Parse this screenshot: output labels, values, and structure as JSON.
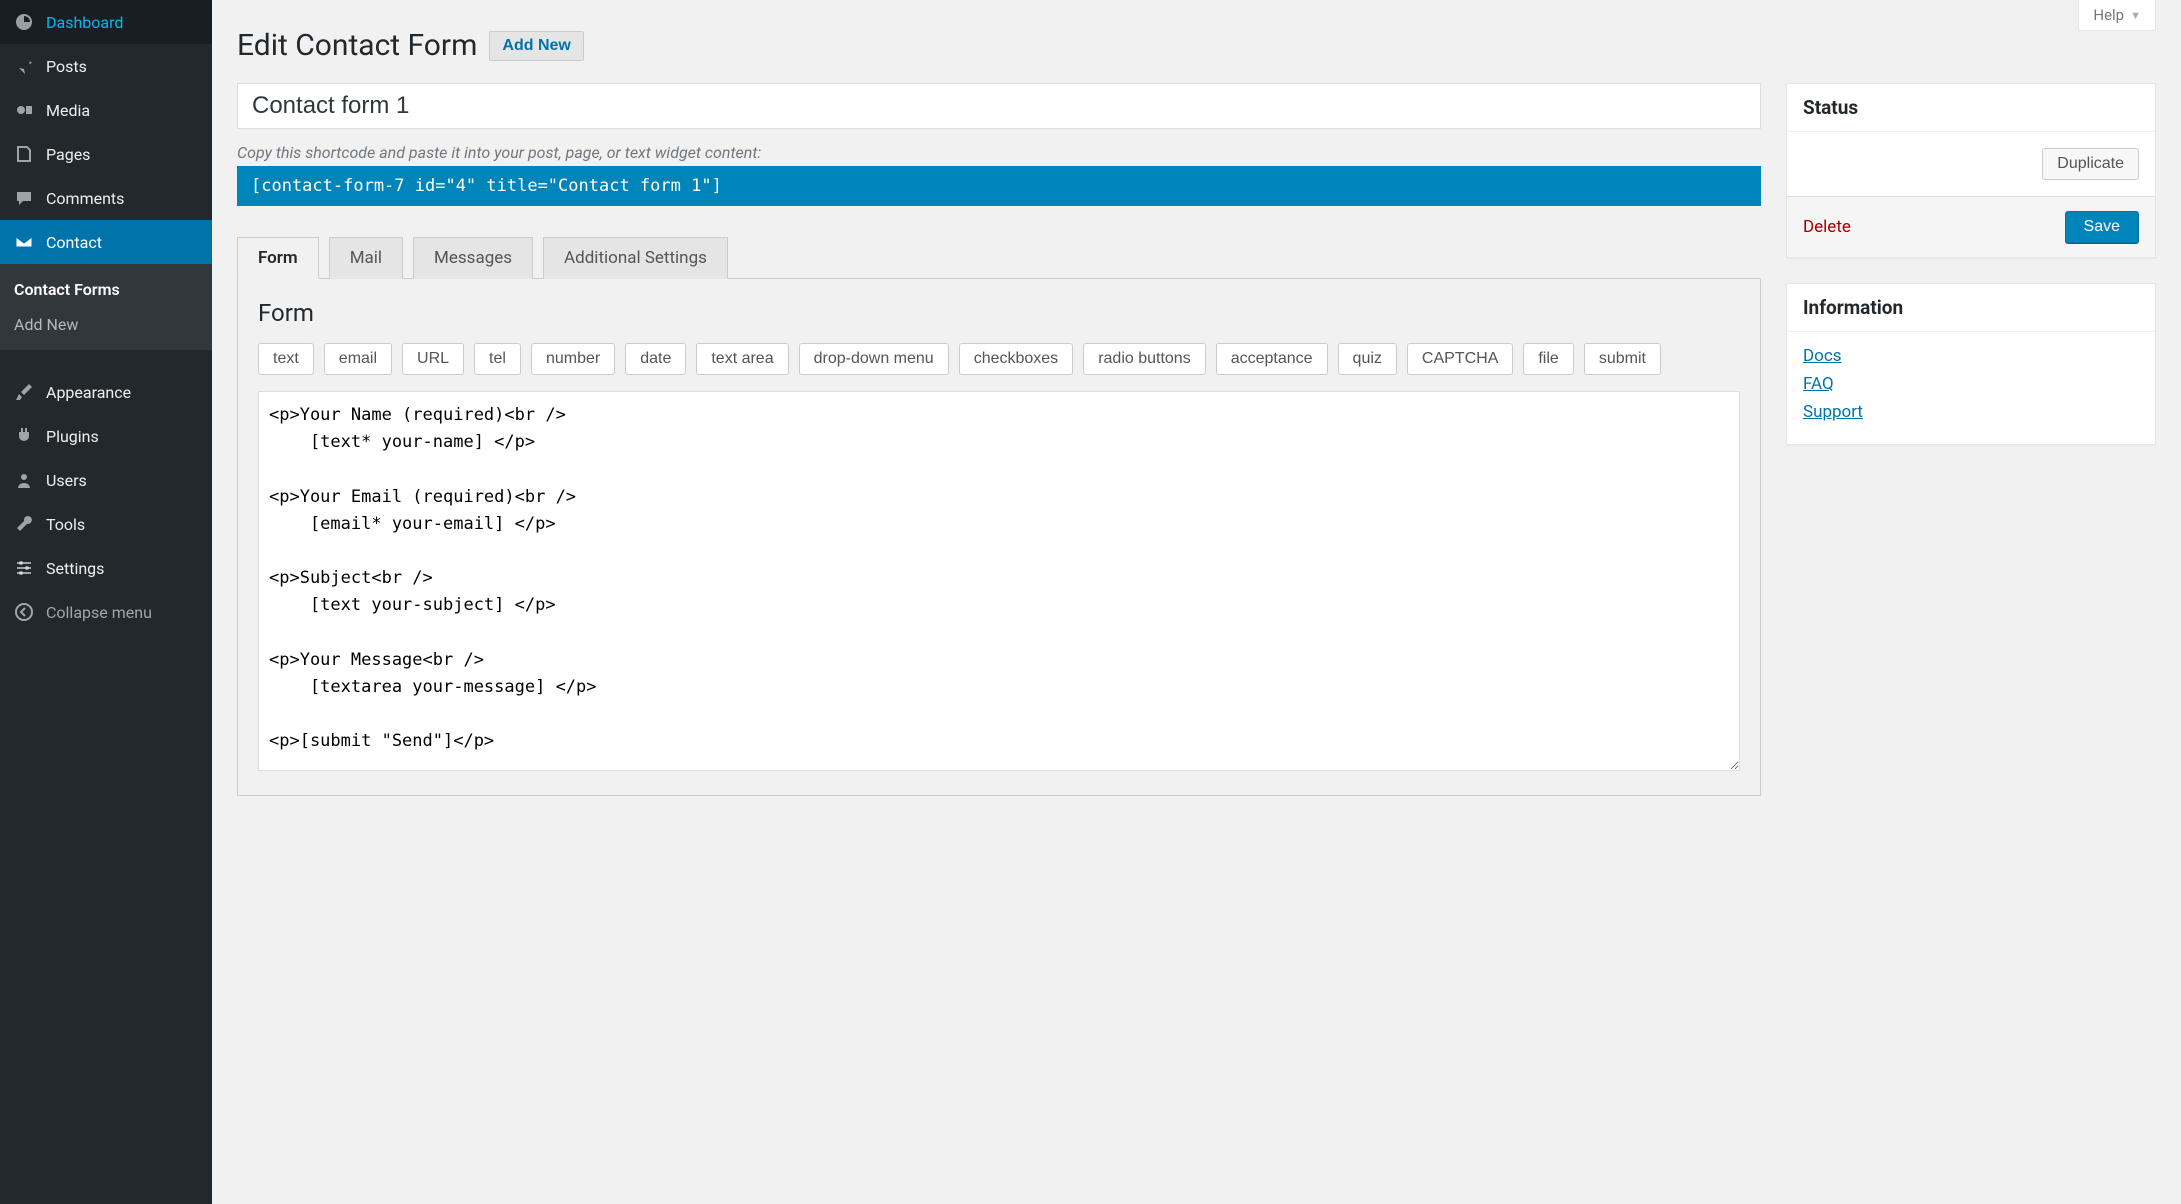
{
  "help_label": "Help",
  "sidebar": {
    "items": [
      {
        "label": "Dashboard"
      },
      {
        "label": "Posts"
      },
      {
        "label": "Media"
      },
      {
        "label": "Pages"
      },
      {
        "label": "Comments"
      },
      {
        "label": "Contact"
      },
      {
        "label": "Appearance"
      },
      {
        "label": "Plugins"
      },
      {
        "label": "Users"
      },
      {
        "label": "Tools"
      },
      {
        "label": "Settings"
      }
    ],
    "submenu": [
      {
        "label": "Contact Forms"
      },
      {
        "label": "Add New"
      }
    ],
    "collapse_label": "Collapse menu"
  },
  "page": {
    "title": "Edit Contact Form",
    "add_new_label": "Add New",
    "form_title_value": "Contact form 1",
    "shortcode_hint": "Copy this shortcode and paste it into your post, page, or text widget content:",
    "shortcode": "[contact-form-7 id=\"4\" title=\"Contact form 1\"]"
  },
  "tabs": [
    {
      "label": "Form"
    },
    {
      "label": "Mail"
    },
    {
      "label": "Messages"
    },
    {
      "label": "Additional Settings"
    }
  ],
  "form_panel": {
    "heading": "Form",
    "tag_buttons": [
      "text",
      "email",
      "URL",
      "tel",
      "number",
      "date",
      "text area",
      "drop-down menu",
      "checkboxes",
      "radio buttons",
      "acceptance",
      "quiz",
      "CAPTCHA",
      "file",
      "submit"
    ],
    "content": "<p>Your Name (required)<br />\n    [text* your-name] </p>\n\n<p>Your Email (required)<br />\n    [email* your-email] </p>\n\n<p>Subject<br />\n    [text your-subject] </p>\n\n<p>Your Message<br />\n    [textarea your-message] </p>\n\n<p>[submit \"Send\"]</p>"
  },
  "status_box": {
    "title": "Status",
    "duplicate_label": "Duplicate",
    "delete_label": "Delete",
    "save_label": "Save"
  },
  "info_box": {
    "title": "Information",
    "links": [
      "Docs",
      "FAQ",
      "Support"
    ]
  }
}
